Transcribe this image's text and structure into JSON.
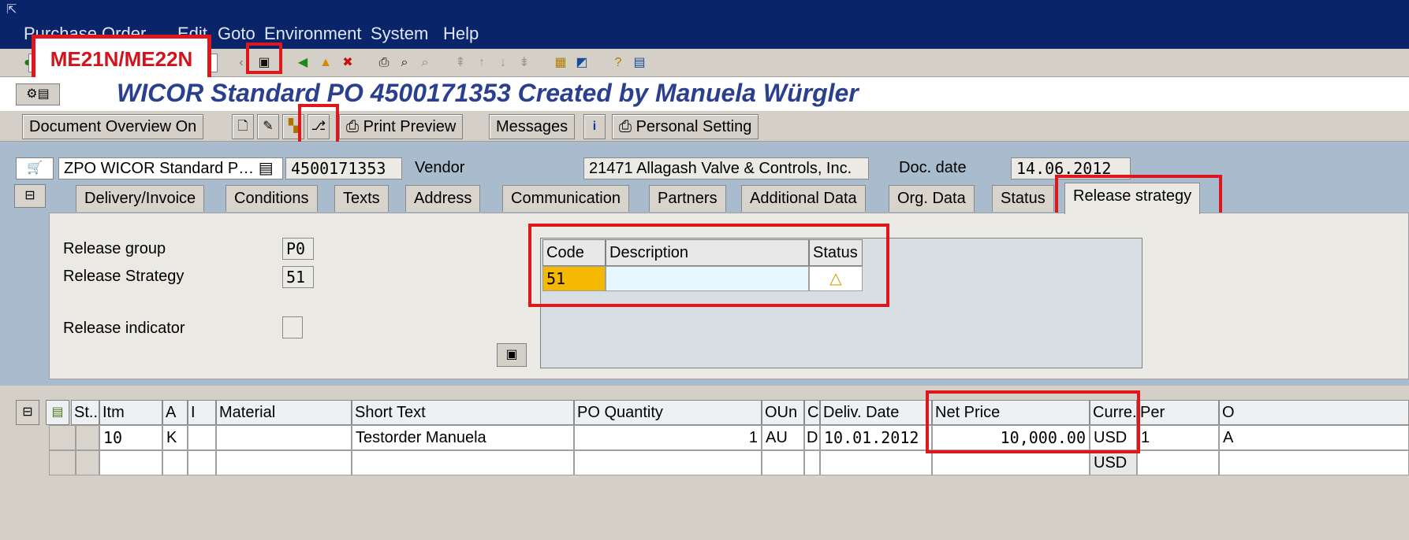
{
  "menu": [
    "Purchase Order",
    "Edit",
    "Goto",
    "Environment",
    "System",
    "Help"
  ],
  "callout": "ME21N/ME22N",
  "page_title": "WICOR Standard PO 4500171353 Created by Manuela Würgler",
  "app_toolbar": {
    "doc_overview": "Document Overview On",
    "print_preview": "Print Preview",
    "messages": "Messages",
    "personal_setting": "Personal Setting"
  },
  "header": {
    "doc_type": "ZPO WICOR Standard P…",
    "po_number": "4500171353",
    "vendor_label": "Vendor",
    "vendor_value": "21471 Allagash Valve & Controls, Inc.",
    "docdate_label": "Doc. date",
    "docdate_value": "14.06.2012"
  },
  "tabs": [
    "Delivery/Invoice",
    "Conditions",
    "Texts",
    "Address",
    "Communication",
    "Partners",
    "Additional Data",
    "Org. Data",
    "Status",
    "Release strategy"
  ],
  "release": {
    "group_label": "Release group",
    "group_value": "P0",
    "strategy_label": "Release Strategy",
    "strategy_value": "51",
    "indicator_label": "Release indicator",
    "table_headers": [
      "Code",
      "Description",
      "Status"
    ],
    "rows": [
      {
        "code": "51",
        "description": "",
        "status": "△"
      }
    ]
  },
  "items": {
    "headers": [
      "St..",
      "Itm",
      "A",
      "I",
      "Material",
      "Short Text",
      "PO Quantity",
      "OUn",
      "C",
      "Deliv. Date",
      "Net Price",
      "Curre.",
      "Per",
      "O"
    ],
    "row1": {
      "itm": "10",
      "a": "K",
      "short_text": "Testorder Manuela",
      "qty": "1",
      "oun": "AU",
      "c": "D",
      "deliv": "10.01.2012",
      "net_price": "10,000.00",
      "curr": "USD",
      "per": "1",
      "o": "A"
    },
    "row2": {
      "curr": "USD"
    }
  },
  "colors": {
    "accent_red": "#e0161d",
    "title_blue": "#2b3f8f",
    "header_bg": "#a8bccd"
  }
}
